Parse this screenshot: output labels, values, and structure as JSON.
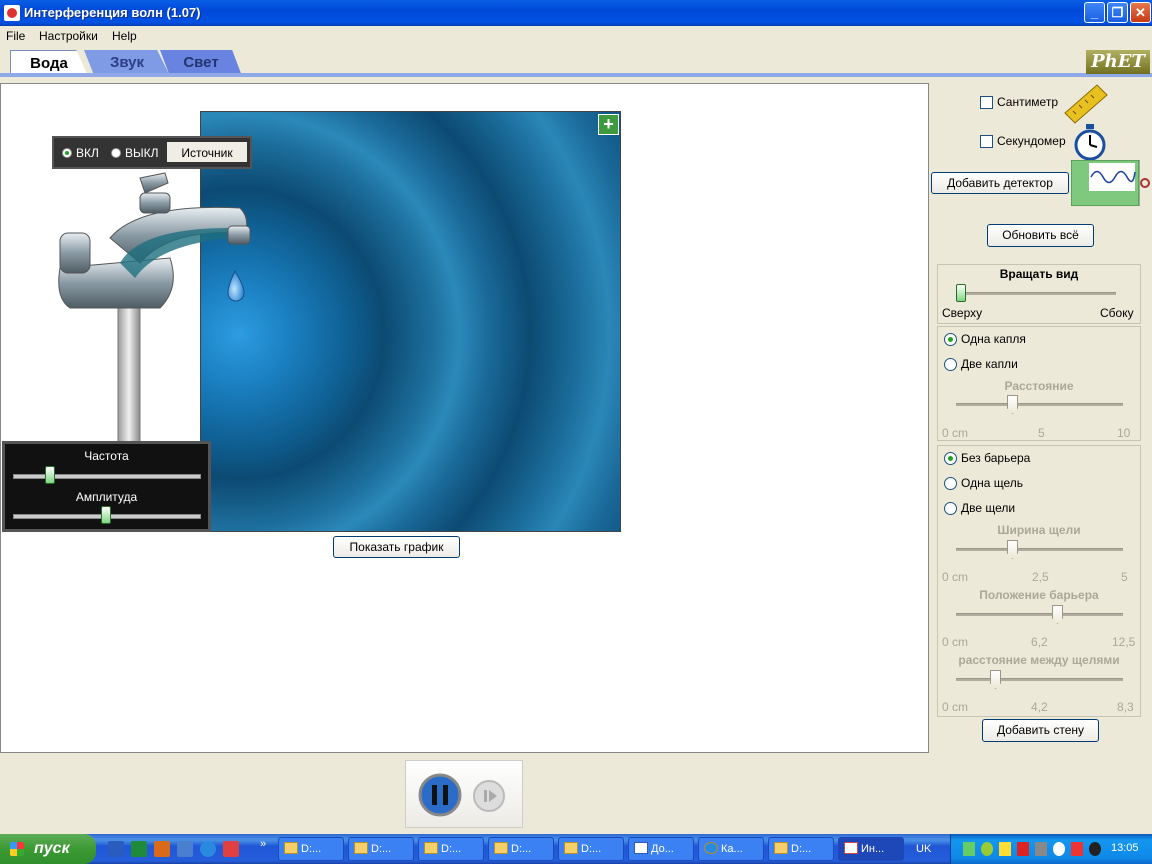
{
  "window": {
    "title": "Интерференция волн (1.07)"
  },
  "menu": [
    "File",
    "Настройки",
    "Help"
  ],
  "tabs": {
    "water": "Вода",
    "sound": "Звук",
    "light": "Свет"
  },
  "logo": "PhET",
  "source": {
    "on_label": "ВКЛ",
    "off_label": "ВЫКЛ",
    "button": "Источник",
    "selected": "ВКЛ"
  },
  "controls": {
    "frequency_label": "Частота",
    "frequency_value": 0.18,
    "amplitude_label": "Амплитуда",
    "amplitude_value": 0.5
  },
  "show_graph": "Показать график",
  "right": {
    "ruler": "Сантиметр",
    "stopwatch": "Секундомер",
    "add_detector": "Добавить детектор",
    "reset_all": "Обновить всё",
    "rotate": {
      "title": "Вращать вид",
      "left": "Сверху",
      "right": "Сбоку",
      "value": 0
    },
    "drops": {
      "one": "Одна капля",
      "two": "Две капли",
      "selected": "one",
      "distance_label": "Расстояние",
      "distance_ticks": [
        "0 cm",
        "5",
        "10"
      ],
      "distance_value": 3.4
    },
    "barrier": {
      "none": "Без барьера",
      "one_slit": "Одна щель",
      "two_slits": "Две щели",
      "selected": "none",
      "slit_width_label": "Ширина щели",
      "slit_width_ticks": [
        "0 cm",
        "2,5",
        "5"
      ],
      "barrier_pos_label": "Положение барьера",
      "barrier_pos_ticks": [
        "0 cm",
        "6,2",
        "12,5"
      ],
      "slit_sep_label": "расстояние между щелями",
      "slit_sep_ticks": [
        "0 cm",
        "4,2",
        "8,3"
      ]
    },
    "add_wall": "Добавить стену"
  },
  "taskbar": {
    "start": "пуск",
    "tasks": [
      "D:...",
      "D:...",
      "D:...",
      "D:...",
      "D:...",
      "До...",
      "Ка...",
      "D:...",
      "Ин..."
    ],
    "lang": "UK",
    "clock": "13:05"
  }
}
